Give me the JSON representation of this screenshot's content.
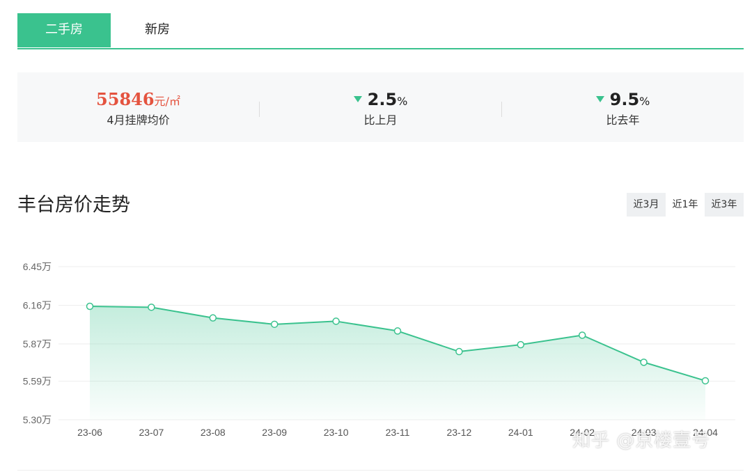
{
  "tabs": [
    {
      "label": "二手房",
      "active": true
    },
    {
      "label": "新房",
      "active": false
    }
  ],
  "stats": {
    "price": {
      "value": "55846",
      "unit": "元/㎡",
      "label": "4月挂牌均价"
    },
    "mom": {
      "value": "2.5",
      "pct": "%",
      "label": "比上月",
      "direction": "down"
    },
    "yoy": {
      "value": "9.5",
      "pct": "%",
      "label": "比去年",
      "direction": "down"
    }
  },
  "section_title": "丰台房价走势",
  "range_buttons": [
    {
      "label": "近3月",
      "selected": false
    },
    {
      "label": "近1年",
      "selected": true
    },
    {
      "label": "近3年",
      "selected": false
    }
  ],
  "watermark": "知乎 @京楼壹号",
  "colors": {
    "accent": "#3ac28e",
    "price": "#e4533f",
    "grid": "#eeeeee",
    "tick": "#666666"
  },
  "chart_data": {
    "type": "area",
    "categories": [
      "23-06",
      "23-07",
      "23-08",
      "23-09",
      "23-10",
      "23-11",
      "23-12",
      "24-01",
      "24-02",
      "24-03",
      "24-04"
    ],
    "values": [
      6.152,
      6.145,
      6.065,
      6.017,
      6.04,
      5.967,
      5.812,
      5.864,
      5.935,
      5.732,
      5.593
    ],
    "y_ticks": [
      {
        "value": 5.3,
        "label": "5.30万"
      },
      {
        "value": 5.59,
        "label": "5.59万"
      },
      {
        "value": 5.87,
        "label": "5.87万"
      },
      {
        "value": 6.16,
        "label": "6.16万"
      },
      {
        "value": 6.45,
        "label": "6.45万"
      }
    ],
    "ylim": [
      5.3,
      6.45
    ],
    "grid": true,
    "title": "丰台房价走势"
  }
}
